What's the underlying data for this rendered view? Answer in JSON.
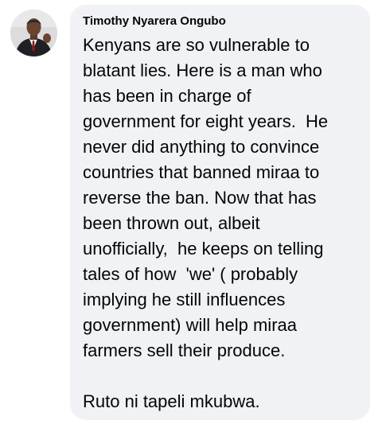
{
  "comment": {
    "author": "Timothy Nyarera Ongubo",
    "avatar_icon": "profile-photo-avatar",
    "bubble_color": "#f0f2f5",
    "text_color": "#050505",
    "lines": [
      "Kenyans are so vulnerable to",
      "blatant lies. Here is a man who",
      "has been in charge of",
      "government for eight years.  He",
      "never did anything to convince",
      "countries that banned miraa to",
      "reverse the ban. Now that has",
      "been thrown out, albeit",
      "unofficially,  he keeps on telling",
      "tales of how  'we' ( probably",
      "implying he still influences",
      "government) will help miraa",
      "farmers sell their produce."
    ],
    "closing_line": "Ruto ni tapeli mkubwa."
  }
}
